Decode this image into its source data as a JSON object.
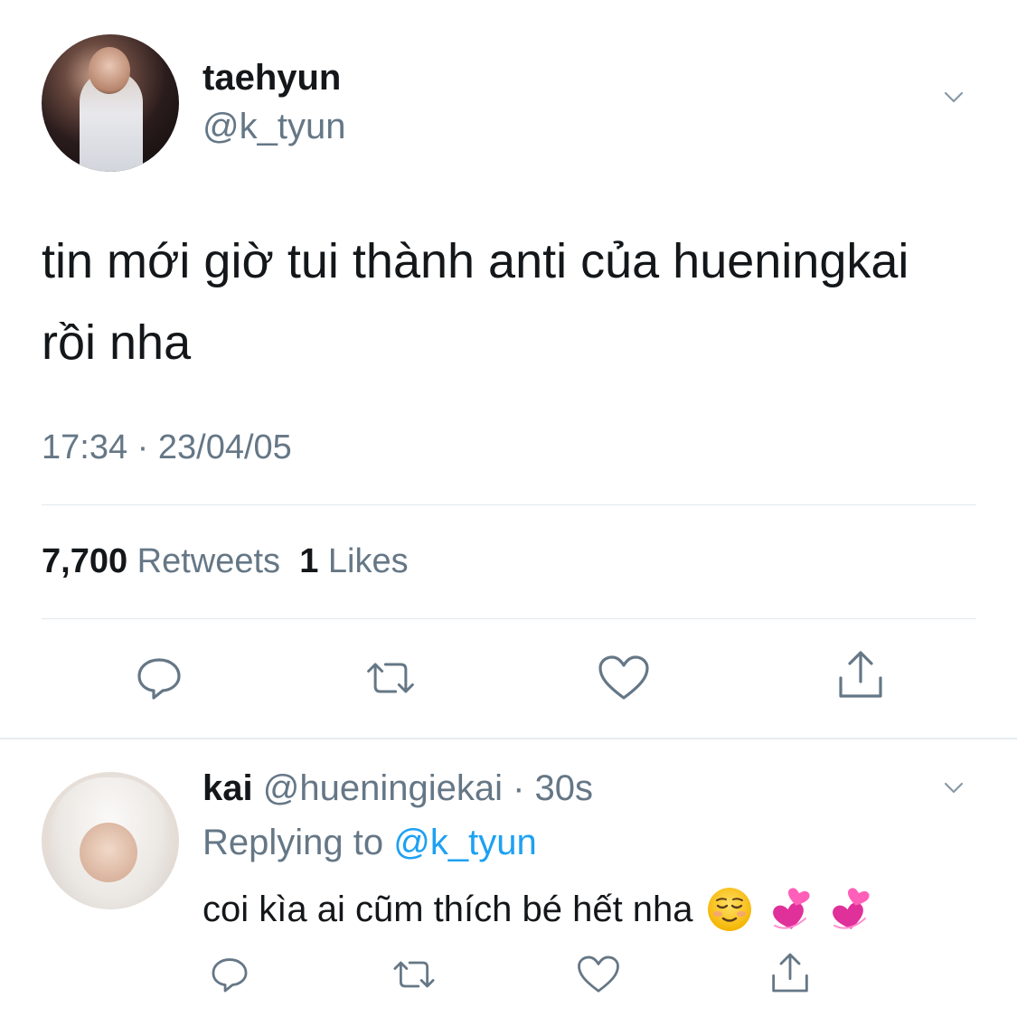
{
  "tweet": {
    "author_name": "taehyun",
    "author_handle": "@k_tyun",
    "text": "tin mới giờ tui thành anti của hueningkai rồi nha",
    "timestamp": "17:34 · 23/04/05",
    "retweets_count": "7,700",
    "retweets_label": "Retweets",
    "likes_count": "1",
    "likes_label": "Likes"
  },
  "reply": {
    "author_name": "kai",
    "author_handle": "@hueningiekai",
    "age": "· 30s",
    "replying_label": "Replying to",
    "replying_handle": "@k_tyun",
    "text": "coi kìa ai cũm thích bé hết nha"
  },
  "colors": {
    "text": "#14171a",
    "secondary": "#657786",
    "accent": "#1da1f2",
    "divider": "#e1e8ed"
  },
  "icons": [
    "chevron-down-icon",
    "reply-icon",
    "retweet-icon",
    "like-icon",
    "share-icon",
    "relieved-face-emoji",
    "revolving-hearts-emoji"
  ]
}
